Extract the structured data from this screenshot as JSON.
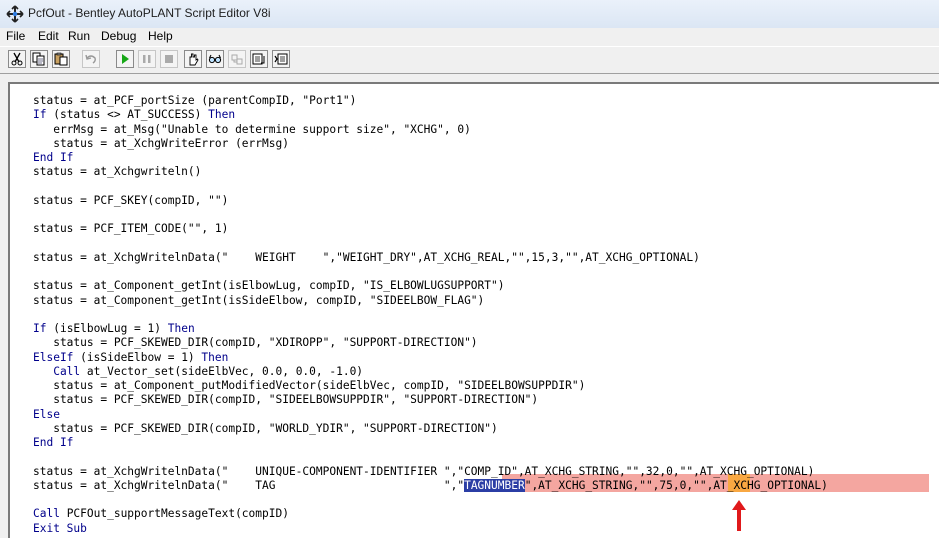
{
  "window": {
    "title": "PcfOut - Bentley AutoPLANT Script Editor V8i"
  },
  "menu": {
    "file": "File",
    "edit": "Edit",
    "run": "Run",
    "debug": "Debug",
    "help": "Help"
  },
  "toolbar": {
    "buttons": [
      "cut-icon",
      "copy-icon",
      "paste-icon",
      "undo-icon",
      "run-icon",
      "pause-icon",
      "stop-icon",
      "hand-icon",
      "glasses-icon",
      "watch-icon",
      "call-stack-icon",
      "step-icon"
    ]
  },
  "code": {
    "l1_a": "status = at_PCF_portSize (parentCompID, \"Port1\")",
    "l2_kw1": "If",
    "l2_a": " (status <> AT_SUCCESS) ",
    "l2_kw2": "Then",
    "l3_a": "   errMsg = at_Msg(\"Unable to determine support size\", \"XCHG\", 0)",
    "l4_a": "   status = at_XchgWriteError (errMsg)",
    "l5_kw": "End If",
    "l6_a": "status = at_Xchgwriteln()",
    "l8_a": "status = PCF_SKEY(compID, \"\")",
    "l10_a": "status = PCF_ITEM_CODE(\"\", 1)",
    "l12_a": "status = at_XchgWritelnData(\"    WEIGHT    \",\"WEIGHT_DRY\",AT_XCHG_REAL,\"\",15,3,\"\",AT_XCHG_OPTIONAL)",
    "l14_a": "status = at_Component_getInt(isElbowLug, compID, \"IS_ELBOWLUGSUPPORT\")",
    "l15_a": "status = at_Component_getInt(isSideElbow, compID, \"SIDEELBOW_FLAG\")",
    "l17_kw1": "If",
    "l17_a": " (isElbowLug = 1) ",
    "l17_kw2": "Then",
    "l18_a": "   status = PCF_SKEWED_DIR(compID, \"XDIROPP\", \"SUPPORT-DIRECTION\")",
    "l19_kw1": "ElseIf",
    "l19_a": " (isSideElbow = 1) ",
    "l19_kw2": "Then",
    "l20_kw": "   Call",
    "l20_a": " at_Vector_set(sideElbVec, 0.0, 0.0, -1.0)",
    "l21_a": "   status = at_Component_putModifiedVector(sideElbVec, compID, \"SIDEELBOWSUPPDIR\")",
    "l22_a": "   status = PCF_SKEWED_DIR(compID, \"SIDEELBOWSUPPDIR\", \"SUPPORT-DIRECTION\")",
    "l23_kw": "Else",
    "l24_a": "   status = PCF_SKEWED_DIR(compID, \"WORLD_YDIR\", \"SUPPORT-DIRECTION\")",
    "l25_kw": "End If",
    "l27_a": "status = at_XchgWritelnData(\"    UNIQUE-COMPONENT-IDENTIFIER \",\"COMP_ID\",AT_XCHG_STRING,\"\",32,0,\"\",AT_XCHG_OPTIONAL)",
    "l28_a": "status = at_XchgWritelnData(\"    TAG                         \",\"",
    "l28_sel": "TAGNUMBER",
    "l28_b": "\",AT_XCHG_STRING,\"\",",
    "l28_num": "75",
    "l28_c": ",0,\"\",AT_XCHG_OPTIONAL)",
    "l30_kw": "Call",
    "l30_a": " PCFOut_supportMessageText(compID)",
    "l31_kw": "Exit Sub"
  },
  "colors": {
    "keyword": "#00008b",
    "highlight": "#f4a6a0",
    "number_highlight": "#f9a842",
    "selection": "#2b3ea5",
    "arrow": "#e0191b"
  }
}
